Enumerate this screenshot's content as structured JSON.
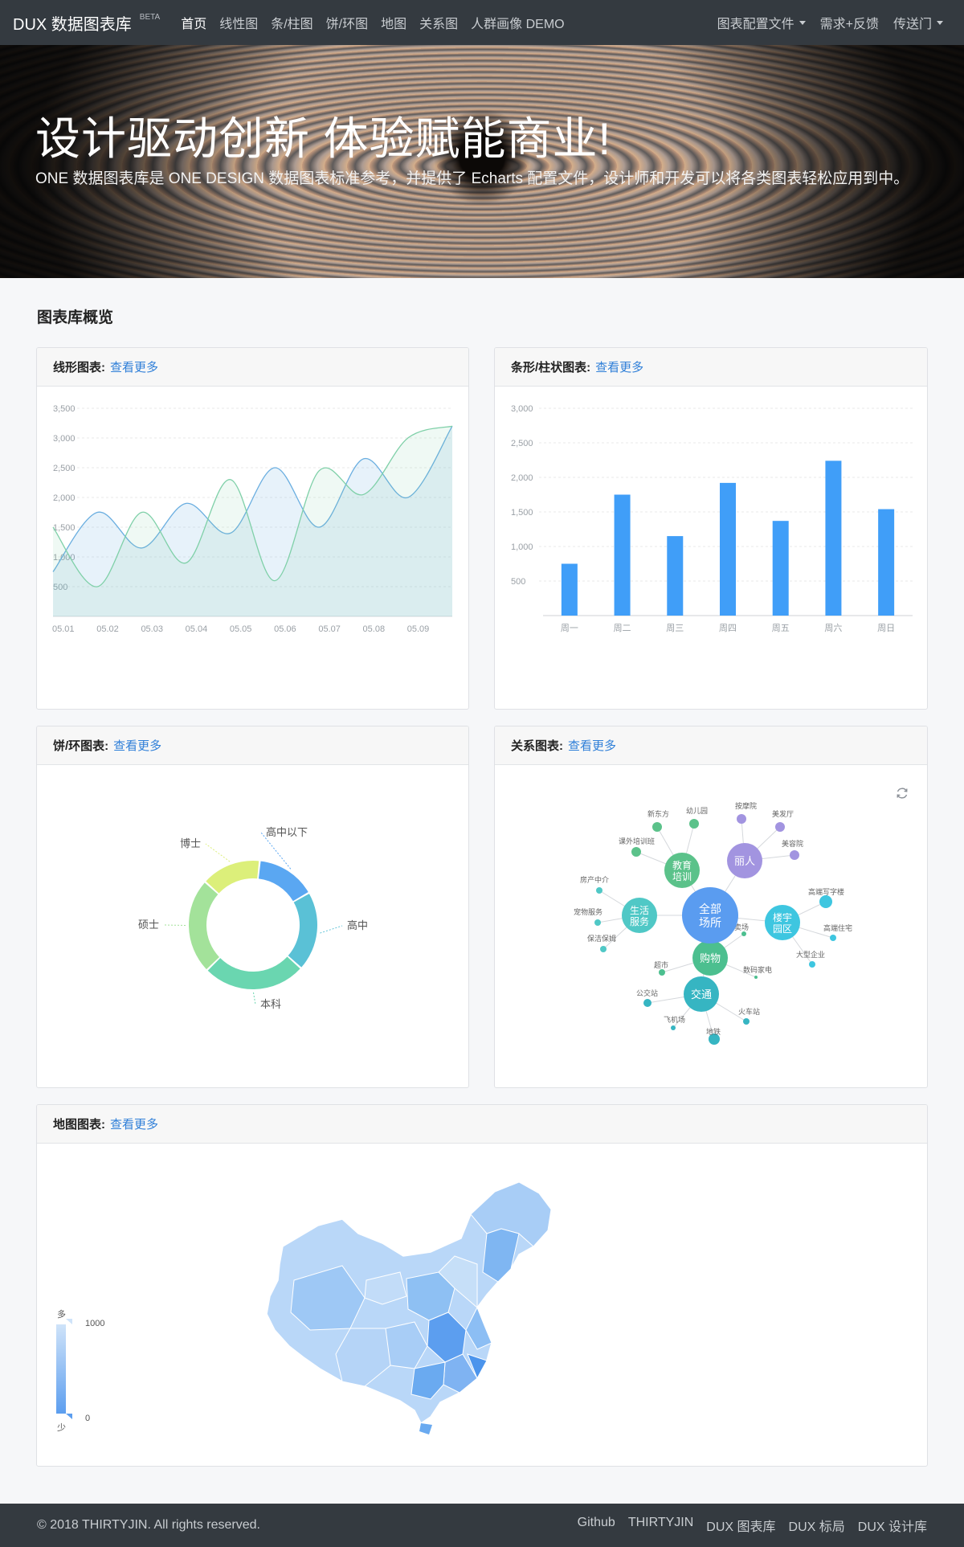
{
  "navbar": {
    "brand": "DUX 数据图表库",
    "badge": "BETA",
    "links": [
      "首页",
      "线性图",
      "条/柱图",
      "饼/环图",
      "地图",
      "关系图",
      "人群画像 DEMO"
    ],
    "right_links": [
      "图表配置文件",
      "需求+反馈",
      "传送门"
    ]
  },
  "hero": {
    "title": "设计驱动创新 体验赋能商业!",
    "subtitle": "ONE 数据图表库是 ONE DESIGN 数据图表标准参考，并提供了 Echarts 配置文件，设计师和开发可以将各类图表轻松应用到中。"
  },
  "section_title": "图表库概览",
  "cards": {
    "line": {
      "label": "线形图表:",
      "more": "查看更多"
    },
    "bar": {
      "label": "条形/柱状图表:",
      "more": "查看更多"
    },
    "pie": {
      "label": "饼/环图表:",
      "more": "查看更多"
    },
    "graph": {
      "label": "关系图表:",
      "more": "查看更多"
    },
    "map": {
      "label": "地图图表:",
      "more": "查看更多"
    }
  },
  "colors": {
    "line_a": "#6aaee0",
    "line_b": "#7fd0a8",
    "bar": "#409ef8",
    "pie": [
      "#5aa7f2",
      "#5ac1d6",
      "#6ad6b0",
      "#a3e29a",
      "#dcef7a"
    ]
  },
  "chart_data": [
    {
      "type": "line",
      "categories": [
        "05.01",
        "05.02",
        "05.03",
        "05.04",
        "05.05",
        "05.06",
        "05.07",
        "05.08",
        "05.09"
      ],
      "ylim": [
        0,
        3500
      ],
      "yticks": [
        "3,500",
        "3,000",
        "2,500",
        "2,000",
        "1,500",
        "1,000",
        "500"
      ],
      "x_points": [
        "05.01",
        "05.02",
        "05.03",
        "05.04",
        "05.05",
        "05.06",
        "05.07",
        "05.08",
        "05.09",
        ""
      ],
      "series": [
        {
          "values": [
            750,
            1750,
            1150,
            1900,
            1400,
            2500,
            1500,
            2650,
            2000,
            3200
          ]
        },
        {
          "values": [
            1500,
            500,
            1750,
            900,
            2300,
            600,
            2450,
            2050,
            3000,
            3200
          ]
        }
      ]
    },
    {
      "type": "bar",
      "categories": [
        "周一",
        "周二",
        "周三",
        "周四",
        "周五",
        "周六",
        "周日"
      ],
      "values": [
        750,
        1750,
        1150,
        1920,
        1370,
        2240,
        1540
      ],
      "ylim": [
        0,
        3000
      ],
      "yticks": [
        "3,000",
        "2,500",
        "2,000",
        "1,500",
        "1,000",
        "500"
      ]
    },
    {
      "type": "pie",
      "labels": [
        "高中以下",
        "高中",
        "本科",
        "硕士",
        "博士"
      ],
      "values": [
        15,
        20,
        26,
        24,
        15
      ]
    },
    {
      "type": "graph",
      "center": "全部场所",
      "hubs": [
        "教育培训",
        "丽人",
        "生活服务",
        "楼宇园区",
        "购物",
        "交通"
      ],
      "leaves": [
        "新东方",
        "幼儿园",
        "课外培训班",
        "按摩院",
        "美发厅",
        "美容院",
        "房产中介",
        "宠物服务",
        "保洁保姆",
        "高端写字楼",
        "高端住宅",
        "大型企业",
        "卖场",
        "超市",
        "数码家电",
        "公交站",
        "火车站",
        "飞机场",
        "地铁"
      ]
    },
    {
      "type": "map",
      "legend_max": "1000",
      "legend_min": "0",
      "legend_high": "多",
      "legend_low": "少"
    }
  ],
  "footer": {
    "copyright": "© 2018 THIRTYJIN. All rights reserved.",
    "links": [
      "Github",
      "THIRTYJIN",
      "DUX 图表库",
      "DUX 标局",
      "DUX 设计库"
    ]
  }
}
